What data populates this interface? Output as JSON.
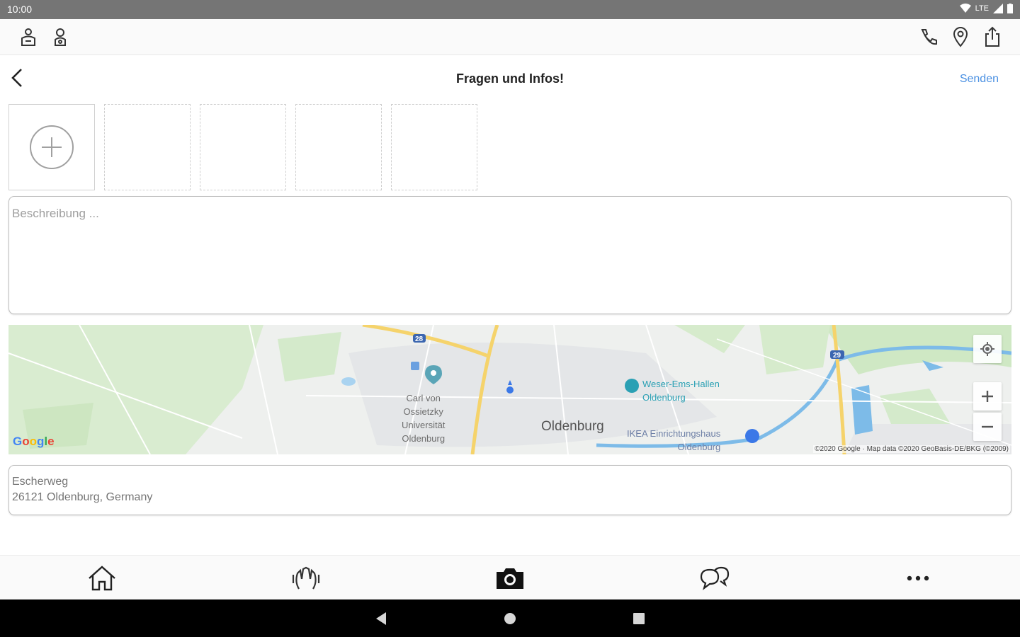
{
  "status_bar": {
    "time": "10:00",
    "network": "LTE"
  },
  "header": {
    "title": "Fragen und Infos!",
    "send_label": "Senden"
  },
  "description": {
    "placeholder": "Beschreibung ..."
  },
  "map": {
    "labels": {
      "university": "Carl von\nOssietzky\nUniversität\nOldenburg",
      "city": "Oldenburg",
      "poi_1": "Weser-Ems-Hallen\nOldenburg",
      "poi_2": "IKEA Einrichtungshaus\nOldenburg",
      "road_a": "28",
      "road_b": "29"
    },
    "logo": "Google",
    "attribution": "©2020 Google · Map data ©2020 GeoBasis-DE/BKG (©2009)"
  },
  "address": {
    "line1": "Escherweg",
    "line2": "26121 Oldenburg, Germany"
  },
  "colors": {
    "accent": "#4a90e2",
    "water": "#7dbbe8",
    "park": "#cfe8c4",
    "highway": "#f5d36b"
  }
}
